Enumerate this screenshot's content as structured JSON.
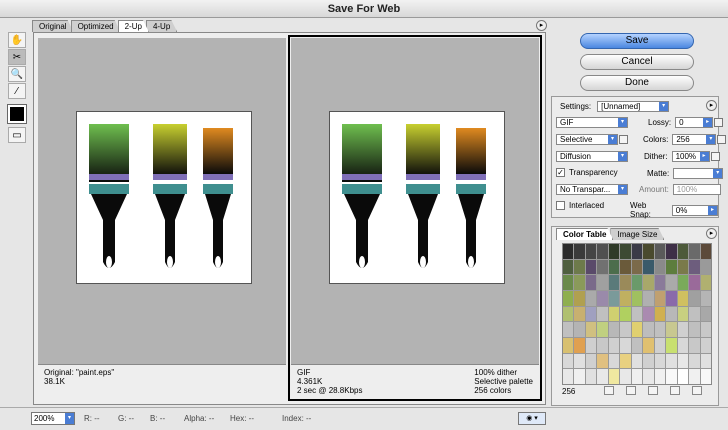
{
  "window": {
    "title": "Save For Web"
  },
  "tabs": [
    "Original",
    "Optimized",
    "2-Up",
    "4-Up"
  ],
  "active_tab": 2,
  "tools": [
    "hand-icon",
    "slice-select-icon",
    "zoom-icon",
    "eyedropper-icon"
  ],
  "panes": [
    {
      "info_left": [
        "Original: \"paint.eps\"",
        "38.1K"
      ],
      "info_right": []
    },
    {
      "info_left": [
        "GIF",
        "4.361K",
        "2 sec @ 28.8Kbps"
      ],
      "info_right": [
        "100% dither",
        "Selective palette",
        "256 colors"
      ]
    }
  ],
  "buttons": {
    "save": "Save",
    "cancel": "Cancel",
    "done": "Done"
  },
  "settings": {
    "label": "Settings:",
    "preset": "[Unnamed]",
    "format": "GIF",
    "lossy_label": "Lossy:",
    "lossy_value": "0",
    "palette": "Selective",
    "colors_label": "Colors:",
    "colors_value": "256",
    "dither_algo": "Diffusion",
    "dither_label": "Dither:",
    "dither_value": "100%",
    "transparency_label": "Transparency",
    "matte_label": "Matte:",
    "trans_dither": "No Transpar...",
    "amount_label": "Amount:",
    "amount_value": "100%",
    "interlaced_label": "Interlaced",
    "websnap_label": "Web Snap:",
    "websnap_value": "0%"
  },
  "color_table": {
    "tabs": [
      "Color Table",
      "Image Size"
    ],
    "count": "256",
    "colors": [
      "#2b2b2b",
      "#3a3a3a",
      "#454545",
      "#505050",
      "#2f3a28",
      "#3d4a33",
      "#3b3b47",
      "#4a4a2e",
      "#5a5a5a",
      "#3e2f47",
      "#4d5a3a",
      "#6a6a6a",
      "#5c4a3a",
      "#4f5f3f",
      "#6d7a4b",
      "#5a4a6a",
      "#717171",
      "#4c6d4c",
      "#6a5a3a",
      "#7b6a4a",
      "#3a5a6a",
      "#8a8a8a",
      "#5d7d3d",
      "#7a7a4a",
      "#6d5d7d",
      "#9a9a9a",
      "#6a8a4a",
      "#8a9a5a",
      "#7a6a8a",
      "#a0a0a0",
      "#5a7a7a",
      "#9a8a5a",
      "#6a9a6a",
      "#a8a86a",
      "#8a7a9a",
      "#aaaaaa",
      "#7aaa5a",
      "#9a6a9a",
      "#b0b070",
      "#8faf4f",
      "#b0a050",
      "#aaaaaa",
      "#9a8aaa",
      "#7a9a9a",
      "#c0b060",
      "#a0c060",
      "#b0b0b0",
      "#c0a070",
      "#8a6aaa",
      "#d0c060",
      "#a0a0a0",
      "#b5b5b5",
      "#b0c070",
      "#c8b070",
      "#a0a0c0",
      "#c0c0c0",
      "#d0d070",
      "#b0d060",
      "#c0c0c0",
      "#aa8ab0",
      "#d0b050",
      "#b8b8b8",
      "#c8d080",
      "#c0c0c0",
      "#a8a8a8",
      "#c0c0c0",
      "#b4b4b4",
      "#d0c080",
      "#c0d080",
      "#b8b8b8",
      "#c8c8c8",
      "#e0d070",
      "#bdbdbd",
      "#c0c0c0",
      "#c8c890",
      "#d0d0d0",
      "#bfbfbf",
      "#c8c8c8",
      "#d8c070",
      "#e0a050",
      "#cfcfcf",
      "#c8c8c8",
      "#d0d0d0",
      "#d8d8d8",
      "#c0c0c0",
      "#e0c070",
      "#d0d0d0",
      "#c8e070",
      "#d8d8d8",
      "#c8c8c8",
      "#d0d0d0",
      "#d8d8d8",
      "#e0e0e0",
      "#d0d0d0",
      "#e0c080",
      "#d8d8d8",
      "#e8d080",
      "#e0e0e0",
      "#d0d0d0",
      "#d8d8d8",
      "#e0e0e0",
      "#e8e8e8",
      "#d8d8d8",
      "#e0e0e0",
      "#e8e8e8",
      "#f0f0f0",
      "#e0e0e0",
      "#e8e8e8",
      "#f0e8a0",
      "#e8e8e8",
      "#f0f0f0",
      "#e8e8e8",
      "#f0f0f0",
      "#f8f8f8",
      "#ffffff",
      "#f0f0f0",
      "#f8f8f8"
    ]
  },
  "status": {
    "zoom": "200%",
    "r": "R:  --",
    "g": "G:  --",
    "b": "B:  --",
    "alpha": "Alpha:  --",
    "hex": "Hex:  --",
    "index": "Index:  --"
  }
}
